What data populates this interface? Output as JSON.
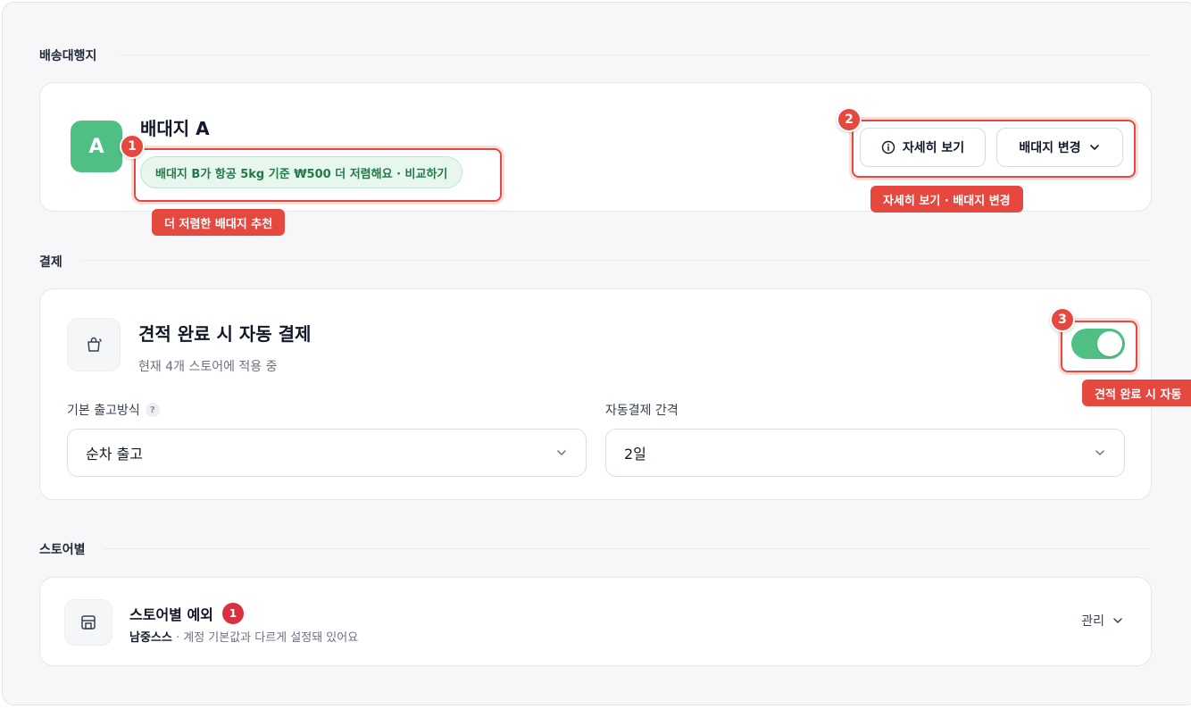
{
  "sections": {
    "carrier": "배송대행지",
    "payment": "결제",
    "store": "스토어별"
  },
  "carrier_card": {
    "avatar": "A",
    "name": "배대지 A",
    "promo": "배대지 B가 항공 5kg 기준 ₩500 더 저렴해요 · 비교하기",
    "detail_button": "자세히 보기",
    "change_button": "배대지 변경"
  },
  "payment_card": {
    "title": "견적 완료 시 자동 결제",
    "subtitle": "현재 4개 스토어에 적용 중",
    "auto_pay_enabled": true,
    "default_shipping_label": "기본 출고방식",
    "help_glyph": "?",
    "default_shipping_value": "순차 출고",
    "interval_label": "자동결제 간격",
    "interval_value": "2일"
  },
  "store_card": {
    "title": "스토어별 예외",
    "exception_count": "1",
    "store_name": "남중스스",
    "description": " · 계정 기본값과 다르게 설정돼 있어요",
    "manage": "관리"
  },
  "annotations": [
    {
      "number": "1",
      "label": "더 저렴한 배대지 추천"
    },
    {
      "number": "2",
      "label": "자세히 보기 · 배대지 변경"
    },
    {
      "number": "3",
      "label": "견적 완료 시 자동"
    }
  ],
  "colors": {
    "accent_green": "#4fbf84",
    "annotation_red": "#e5483f",
    "badge_red": "#dc2f3f"
  }
}
